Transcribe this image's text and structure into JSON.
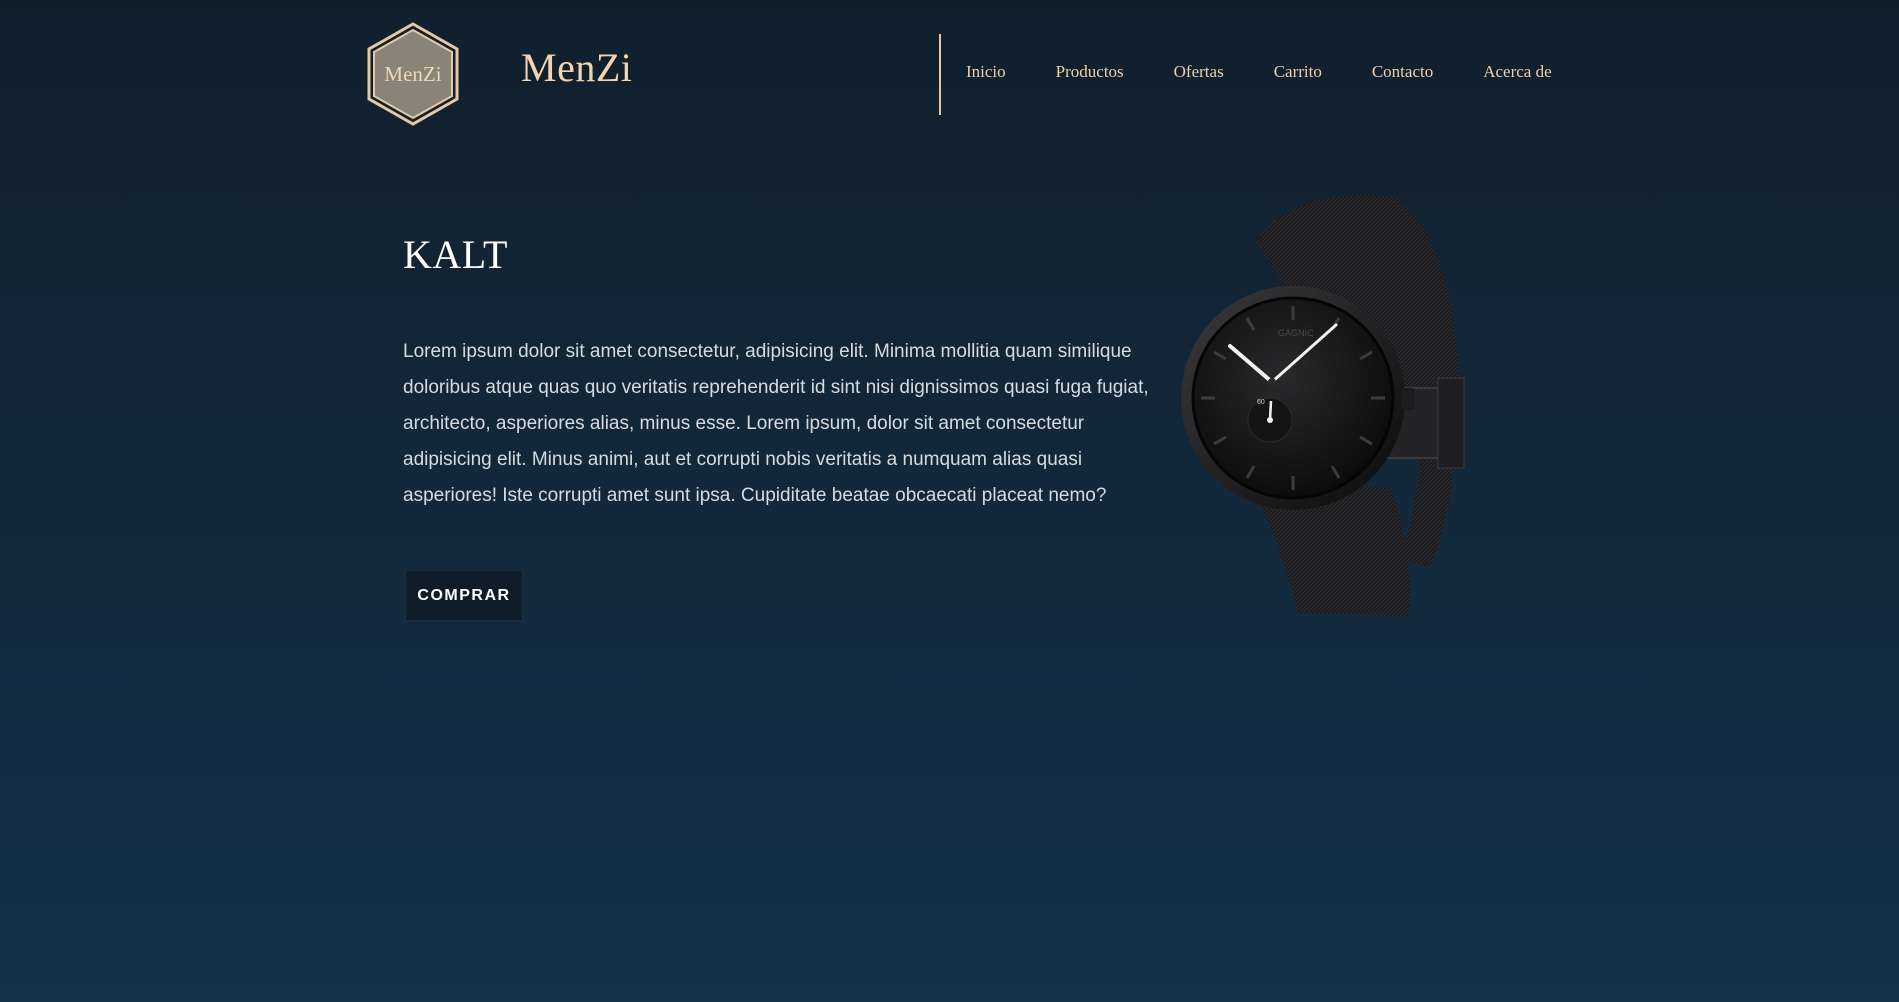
{
  "header": {
    "logo_text": "MenZi",
    "brand_name": "MenZi",
    "nav": [
      {
        "label": "Inicio"
      },
      {
        "label": "Productos"
      },
      {
        "label": "Ofertas"
      },
      {
        "label": "Carrito"
      },
      {
        "label": "Contacto"
      },
      {
        "label": "Acerca de"
      }
    ]
  },
  "hero": {
    "title": "KALT",
    "description": "Lorem ipsum dolor sit amet consectetur, adipisicing elit. Minima mollitia quam similique doloribus atque quas quo veritatis reprehenderit id sint nisi dignissimos quasi fuga fugiat, architecto, asperiores alias, minus esse. Lorem ipsum, dolor sit amet consectetur adipisicing elit. Minus animi, aut et corrupti nobis veritatis a numquam alias quasi asperiores! Iste corrupti amet sunt ipsa. Cupiditate beatae obcaecati placeat nemo?",
    "buy_label": "COMPRAR",
    "watch_brand": "GAGNIC",
    "watch_subdial": "60"
  },
  "colors": {
    "accent": "#f1cfa6",
    "background_top": "#111f2d",
    "background_bottom": "#14304a",
    "button_bg": "#0f1d2b"
  }
}
